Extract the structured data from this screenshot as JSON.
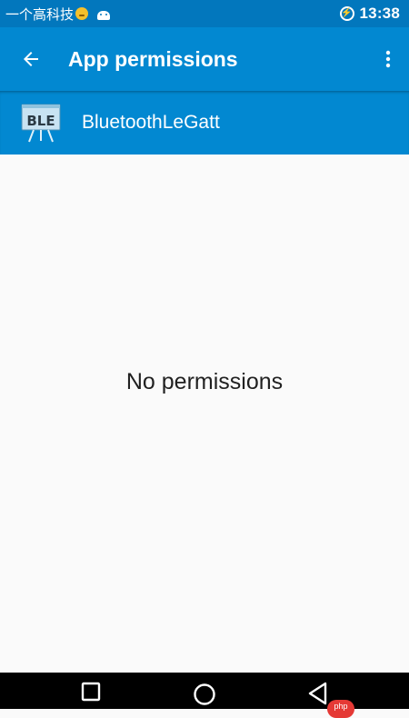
{
  "status_bar": {
    "carrier": "一个高科技",
    "time": "13:38",
    "icons": [
      "emoji-icon",
      "android-icon",
      "battery-charging-icon"
    ]
  },
  "toolbar": {
    "back_icon": "arrow-left-icon",
    "title": "App permissions",
    "overflow_icon": "more-vert-icon"
  },
  "app_header": {
    "icon_text": "BLE",
    "name": "BluetoothLeGatt"
  },
  "content": {
    "empty_message": "No permissions"
  },
  "nav_bar": {
    "buttons": [
      "recents-icon",
      "home-icon",
      "back-triangle-icon"
    ],
    "badge": "php"
  },
  "colors": {
    "status_bar": "#0277bd",
    "toolbar": "#0288d1",
    "background": "#fafafa",
    "nav_bar": "#000000"
  }
}
